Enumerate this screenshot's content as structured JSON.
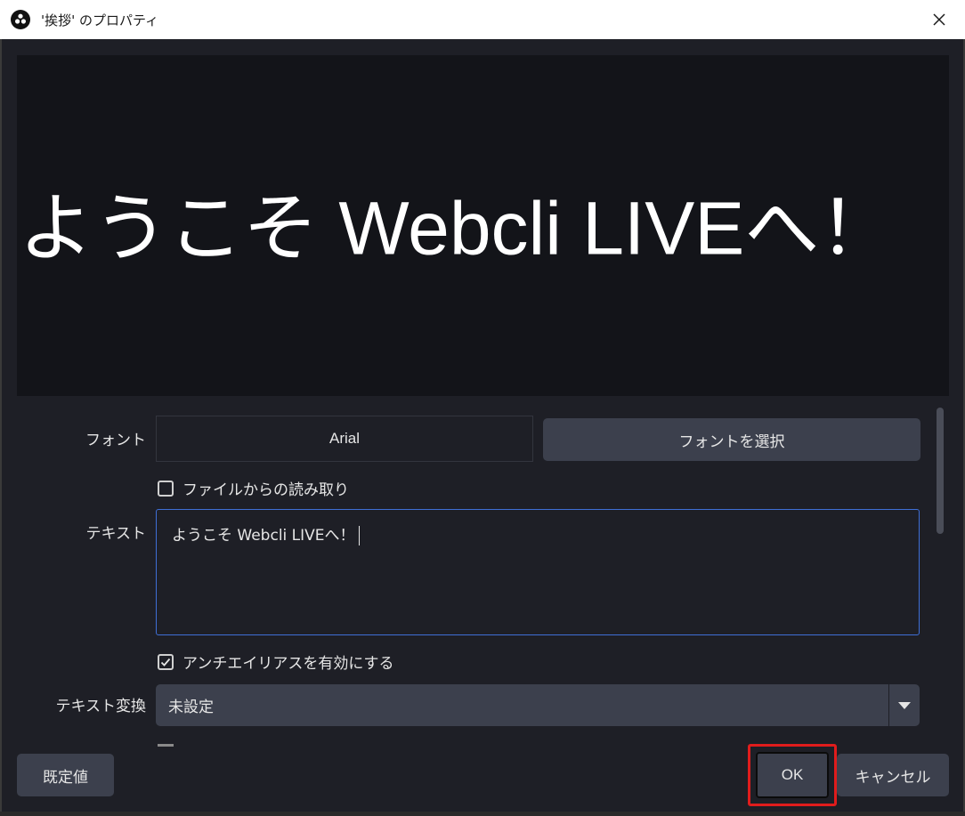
{
  "window": {
    "title": "'挨拶' のプロパティ",
    "app_icon": "obs-icon",
    "close_icon": "close-icon"
  },
  "preview": {
    "text": "ようこそ Webcli LIVEへ！"
  },
  "form": {
    "font_label": "フォント",
    "font_value": "Arial",
    "font_select_button": "フォントを選択",
    "read_from_file_label": "ファイルからの読み取り",
    "read_from_file_checked": false,
    "text_label": "テキスト",
    "text_value": "ようこそ Webcli LIVEへ！",
    "antialias_label": "アンチエイリアスを有効にする",
    "antialias_checked": true,
    "transform_label": "テキスト変換",
    "transform_value": "未設定"
  },
  "footer": {
    "defaults_button": "既定値",
    "ok_button": "OK",
    "cancel_button": "キャンセル"
  },
  "colors": {
    "background": "#1e1f26",
    "preview_bg": "#131419",
    "button_bg": "#3c404d",
    "focus_border": "#3f6fd6",
    "highlight": "#e01c1c"
  }
}
